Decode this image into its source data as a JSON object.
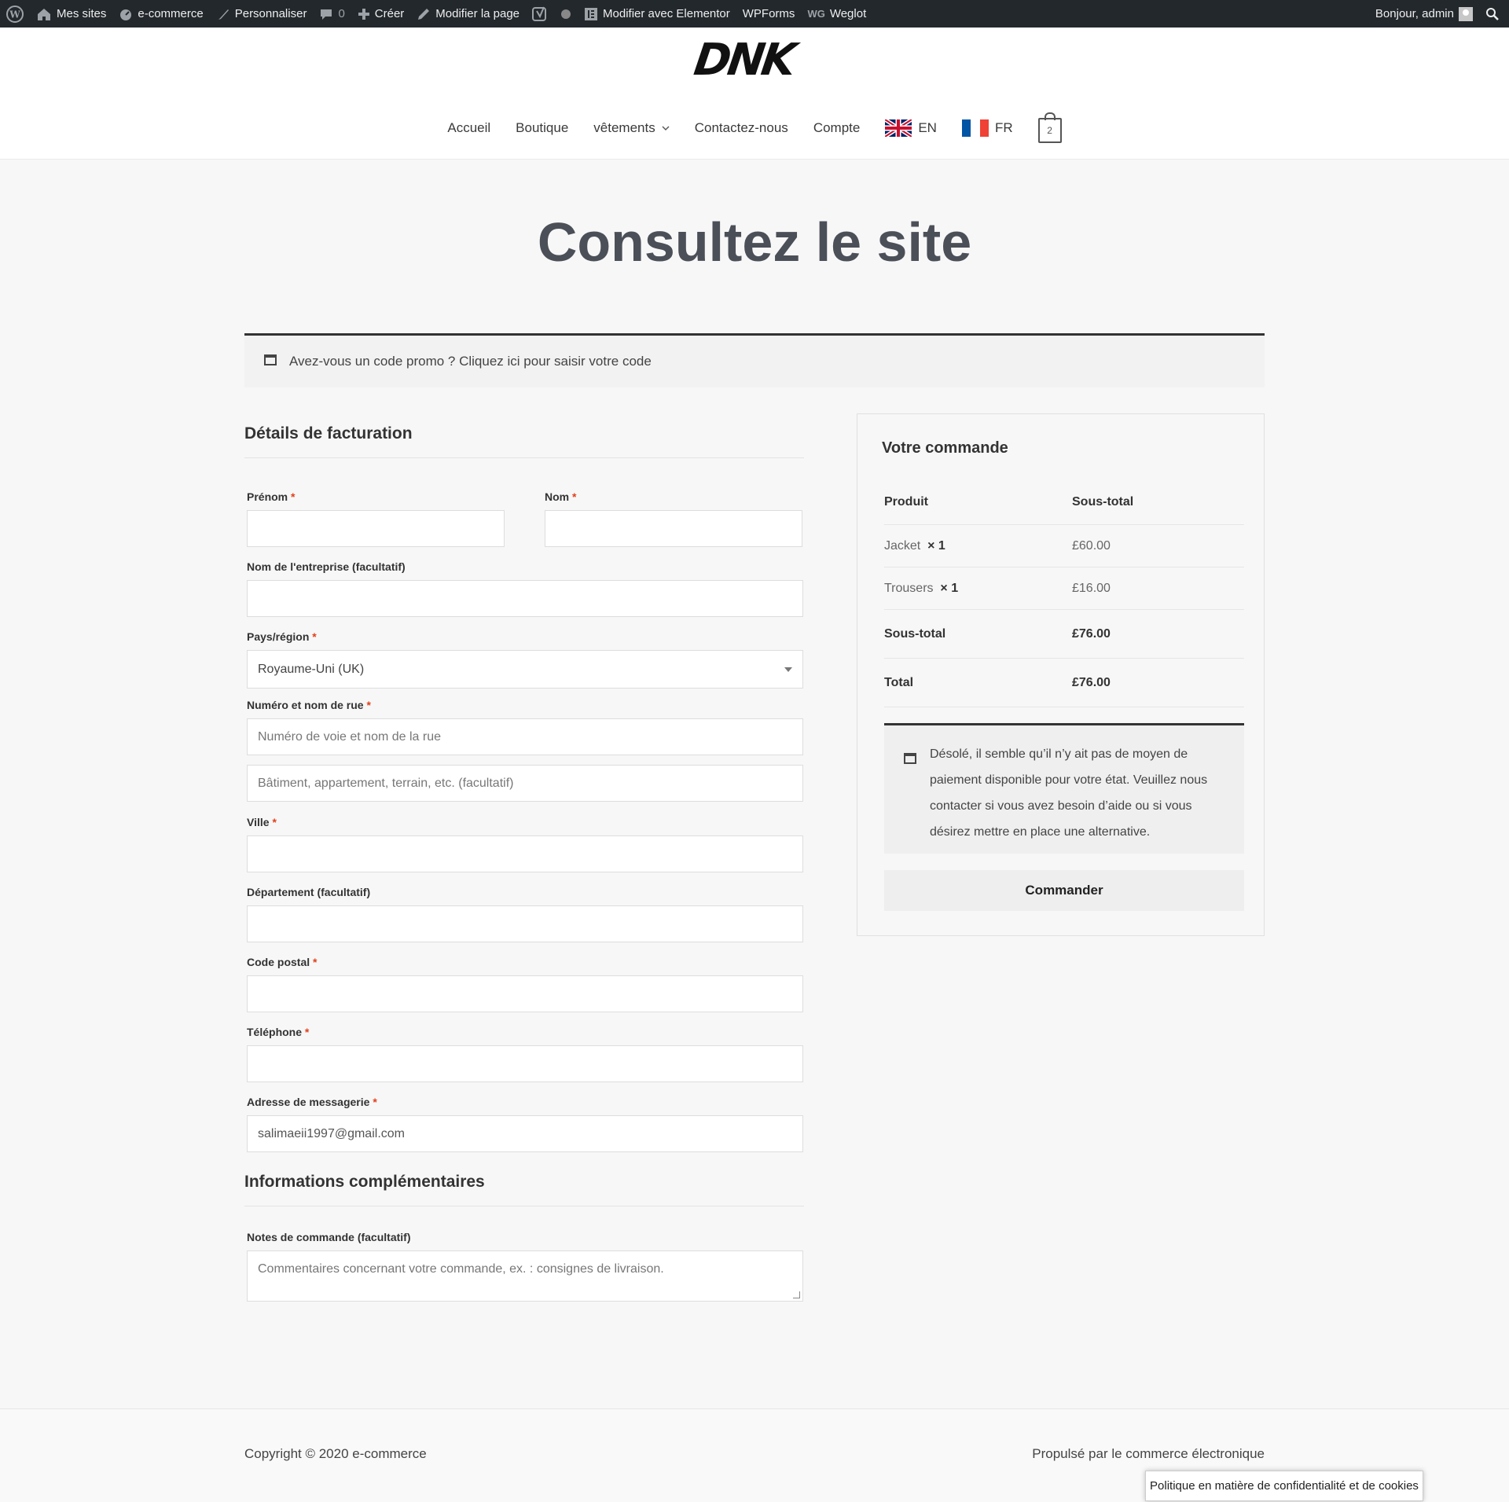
{
  "adminbar": {
    "items": [
      {
        "label": "Mes sites",
        "icon": "home-icon"
      },
      {
        "label": "e-commerce",
        "icon": "dashboard-icon"
      },
      {
        "label": "Personnaliser",
        "icon": "brush-icon"
      },
      {
        "label": "0",
        "icon": "comment-icon"
      },
      {
        "label": "Créer",
        "icon": "plus-icon"
      },
      {
        "label": "Modifier la page",
        "icon": "pencil-icon"
      },
      {
        "label": "Modifier avec Elementor",
        "icon": "elementor-icon"
      },
      {
        "label": "WPForms",
        "icon": ""
      },
      {
        "label": "Weglot",
        "icon": "weglot-icon"
      }
    ],
    "greeting": "Bonjour, admin"
  },
  "header": {
    "logo": "DNK",
    "nav": [
      "Accueil",
      "Boutique",
      "vêtements",
      "Contactez-nous",
      "Compte"
    ],
    "lang_en": "EN",
    "lang_fr": "FR",
    "cart_count": "2"
  },
  "page": {
    "title": "Consultez le site"
  },
  "coupon": {
    "text": "Avez-vous un code promo ? Cliquez ici pour saisir votre code"
  },
  "billing": {
    "heading": "Détails de facturation",
    "required_mark": "*",
    "first_name_label": "Prénom",
    "last_name_label": "Nom",
    "company_label": "Nom de l'entreprise (facultatif)",
    "country_label": "Pays/région",
    "country_value": "Royaume-Uni (UK)",
    "street_label": "Numéro et nom de rue",
    "street_placeholder": "Numéro de voie et nom de la rue",
    "street2_placeholder": "Bâtiment, appartement, terrain, etc. (facultatif)",
    "city_label": "Ville",
    "state_label": "Département (facultatif)",
    "postcode_label": "Code postal",
    "phone_label": "Téléphone",
    "email_label": "Adresse de messagerie",
    "email_value": "salimaeii1997@gmail.com"
  },
  "additional": {
    "heading": "Informations complémentaires",
    "notes_label": "Notes de commande (facultatif)",
    "notes_placeholder": "Commentaires concernant votre commande, ex. : consignes de livraison."
  },
  "order": {
    "heading": "Votre commande",
    "col_product": "Produit",
    "col_subtotal": "Sous-total",
    "items": [
      {
        "name": "Jacket",
        "qty": "× 1",
        "total": "£60.00"
      },
      {
        "name": "Trousers",
        "qty": "× 1",
        "total": "£16.00"
      }
    ],
    "subtotal_label": "Sous-total",
    "subtotal_value": "£76.00",
    "total_label": "Total",
    "total_value": "£76.00",
    "notice": "Désolé, il semble qu’il n’y ait pas de moyen de paiement disponible pour votre état. Veuillez nous contacter si vous avez besoin d’aide ou si vous désirez mettre en place une alternative.",
    "button": "Commander"
  },
  "footer": {
    "copyright": "Copyright © 2020 e-commerce",
    "powered": "Propulsé par le commerce électronique"
  },
  "cookie": {
    "text": "Politique en matière de confidentialité et de cookies"
  }
}
